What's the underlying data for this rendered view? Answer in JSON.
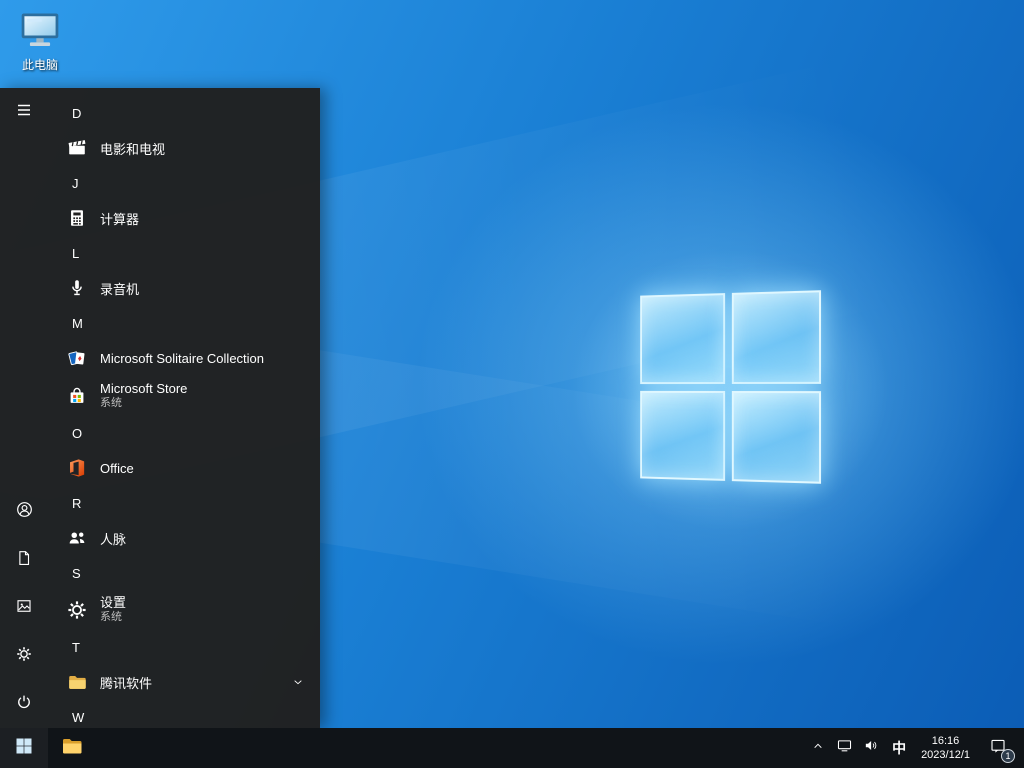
{
  "colors": {
    "accent": "#0078d7",
    "wallpaper_base": "#1272cf",
    "start_menu_bg": "#212121",
    "taskbar_bg": "#101418"
  },
  "desktop": {
    "this_pc": {
      "label": "此电脑",
      "icon": "computer-monitor-icon"
    }
  },
  "start_menu": {
    "rail": {
      "menu_icon": "hamburger-icon",
      "account_icon": "user-icon",
      "documents_icon": "document-icon",
      "pictures_icon": "picture-icon",
      "settings_icon": "gear-icon",
      "power_icon": "power-icon"
    },
    "sections": [
      {
        "letter": "D",
        "items": [
          {
            "label": "电影和电视",
            "icon": "movies-tv-icon"
          }
        ]
      },
      {
        "letter": "J",
        "items": [
          {
            "label": "计算器",
            "icon": "calculator-icon"
          }
        ]
      },
      {
        "letter": "L",
        "items": [
          {
            "label": "录音机",
            "icon": "microphone-icon"
          }
        ]
      },
      {
        "letter": "M",
        "items": [
          {
            "label": "Microsoft Solitaire Collection",
            "icon": "cards-icon"
          },
          {
            "label": "Microsoft Store",
            "sublabel": "系统",
            "icon": "store-bag-icon"
          }
        ]
      },
      {
        "letter": "O",
        "items": [
          {
            "label": "Office",
            "icon": "office-icon"
          }
        ]
      },
      {
        "letter": "R",
        "items": [
          {
            "label": "人脉",
            "icon": "people-icon"
          }
        ]
      },
      {
        "letter": "S",
        "items": [
          {
            "label": "设置",
            "sublabel": "系统",
            "icon": "gear-icon"
          }
        ]
      },
      {
        "letter": "T",
        "items": [
          {
            "label": "腾讯软件",
            "icon": "folder-icon",
            "expandable": true
          }
        ]
      },
      {
        "letter": "W",
        "items": []
      }
    ]
  },
  "taskbar": {
    "start_icon": "windows-logo-icon",
    "explorer_icon": "folder-icon",
    "tray": {
      "hidden_icons_icon": "chevron-up-icon",
      "network_icon": "network-icon",
      "volume_icon": "speaker-icon",
      "ime": "中",
      "time": "16:16",
      "date": "2023/12/1",
      "action_center_icon": "notification-icon",
      "badge": "1"
    }
  }
}
